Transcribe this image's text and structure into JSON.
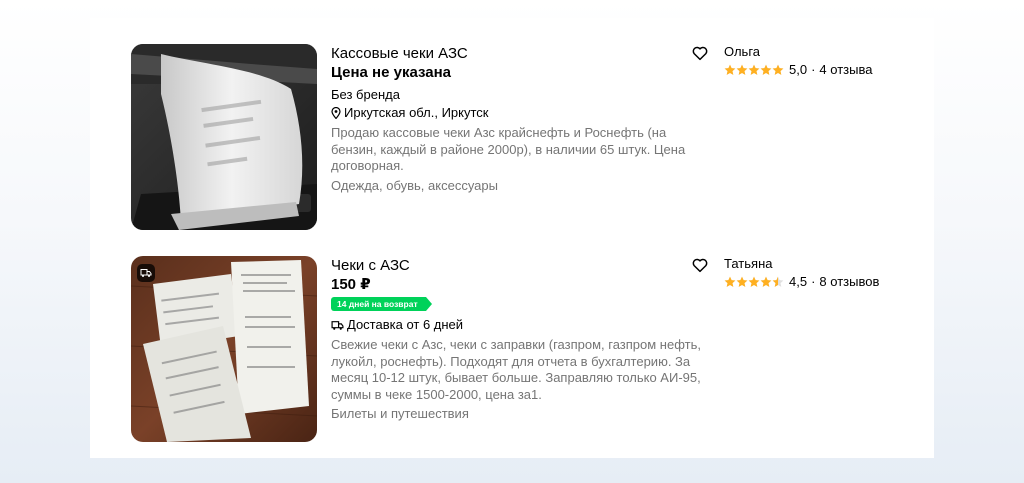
{
  "listings": [
    {
      "title": "Кассовые чеки АЗС",
      "price": "Цена не указана",
      "brand": "Без бренда",
      "location": "Иркутская обл., Иркутск",
      "description": "Продаю кассовые чеки Азс крайснефть и Роснефть (на бензин, каждый в районе 2000р), в наличии 65 штук. Цена договорная.",
      "category": "Одежда, обувь, аксессуары",
      "seller": "Ольга",
      "rating_value": "5,0",
      "rating_fraction": 1.0,
      "reviews": "4 отзыва",
      "photo_icon": "receipt-printer-photo",
      "favorite_icon": "heart-icon"
    },
    {
      "title": "Чеки с АЗС",
      "price": "150 ₽",
      "badge": "14 дней на возврат",
      "delivery": "Доставка от 6 дней",
      "description": "Свежие чеки с Азс, чеки с заправки (газпром, газпром нефть, лукойл, роснефть). Подходят для отчета в бухгалтерию. За месяц 10-12 штук, бывает больше. Заправляю только АИ-95, суммы в чеке 1500-2000, цена за1.",
      "category": "Билеты и путешествия",
      "seller": "Татьяна",
      "rating_value": "4,5",
      "rating_fraction": 0.9,
      "reviews": "8 отзывов",
      "photo_icon": "receipts-on-table-photo",
      "favorite_icon": "heart-icon"
    }
  ],
  "separator": "·",
  "colors": {
    "star": "#ffb021",
    "badge": "#00d25a",
    "muted_text": "#757575"
  }
}
